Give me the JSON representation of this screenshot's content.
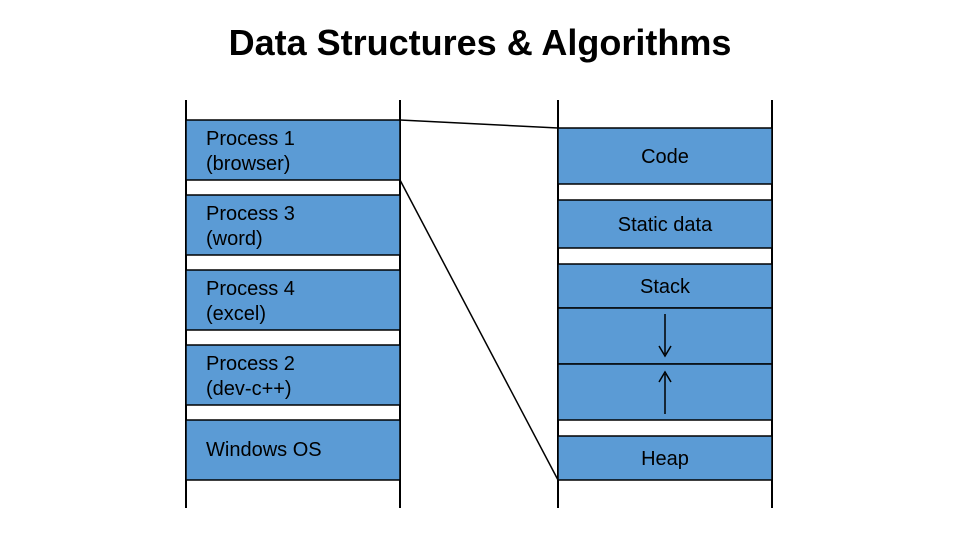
{
  "title": "Data Structures & Algorithms",
  "colors": {
    "box_fill": "#5b9bd5",
    "box_stroke": "#000000",
    "arrow": "#000000"
  },
  "left_column": {
    "cells": [
      {
        "line1": "Process 1",
        "line2": "(browser)"
      },
      {
        "line1": "Process 3",
        "line2": "(word)"
      },
      {
        "line1": "Process 4",
        "line2": "(excel)"
      },
      {
        "line1": "Process 2",
        "line2": "(dev-c++)"
      },
      {
        "line1": "Windows OS",
        "line2": ""
      }
    ]
  },
  "right_column": {
    "cells": [
      {
        "label": "Code"
      },
      {
        "label": "Static data"
      },
      {
        "label": "Stack"
      },
      {
        "label": ""
      },
      {
        "label": ""
      },
      {
        "label": "Heap"
      }
    ]
  },
  "chart_data": {
    "type": "table",
    "title": "Data Structures & Algorithms",
    "left_stack": [
      "Process 1 (browser)",
      "Process 3 (word)",
      "Process 4 (excel)",
      "Process 2 (dev-c++)",
      "Windows OS"
    ],
    "right_stack": [
      "Code",
      "Static data",
      "Stack",
      "",
      "",
      "Heap"
    ],
    "mapping_lines": [
      {
        "from_left_index": 0,
        "to_right_top": 0,
        "to_right_bottom": 5
      }
    ],
    "arrows": [
      {
        "from": "Stack",
        "direction": "down"
      },
      {
        "from": "Heap",
        "direction": "up"
      }
    ]
  }
}
